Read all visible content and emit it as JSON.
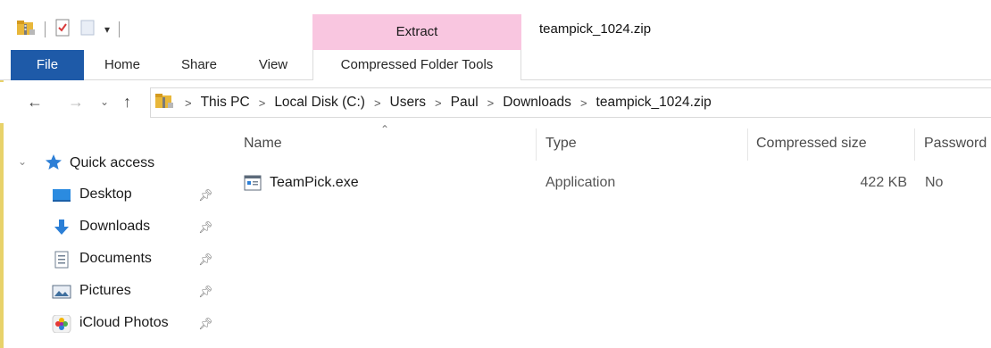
{
  "window": {
    "title": "teampick_1024.zip"
  },
  "ribbon": {
    "context_header": "Extract",
    "tabs": [
      "File",
      "Home",
      "Share",
      "View",
      "Compressed Folder Tools"
    ]
  },
  "address": {
    "crumbs": [
      "This PC",
      "Local Disk (C:)",
      "Users",
      "Paul",
      "Downloads",
      "teampick_1024.zip"
    ]
  },
  "navpane": {
    "quick_access": "Quick access",
    "items": [
      {
        "label": "Desktop",
        "icon": "desktop-icon"
      },
      {
        "label": "Downloads",
        "icon": "download-arrow-icon"
      },
      {
        "label": "Documents",
        "icon": "document-icon"
      },
      {
        "label": "Pictures",
        "icon": "pictures-icon"
      },
      {
        "label": "iCloud Photos",
        "icon": "icloud-photos-icon"
      }
    ]
  },
  "columns": {
    "name": "Name",
    "type": "Type",
    "compressed_size": "Compressed size",
    "password": "Password"
  },
  "files": [
    {
      "name": "TeamPick.exe",
      "type": "Application",
      "compressed_size": "422 KB",
      "password": "No"
    }
  ],
  "colors": {
    "file_tab": "#1e5aa8",
    "extract_tab": "#f9c6e0",
    "folder_yellow": "#e8b73a"
  }
}
